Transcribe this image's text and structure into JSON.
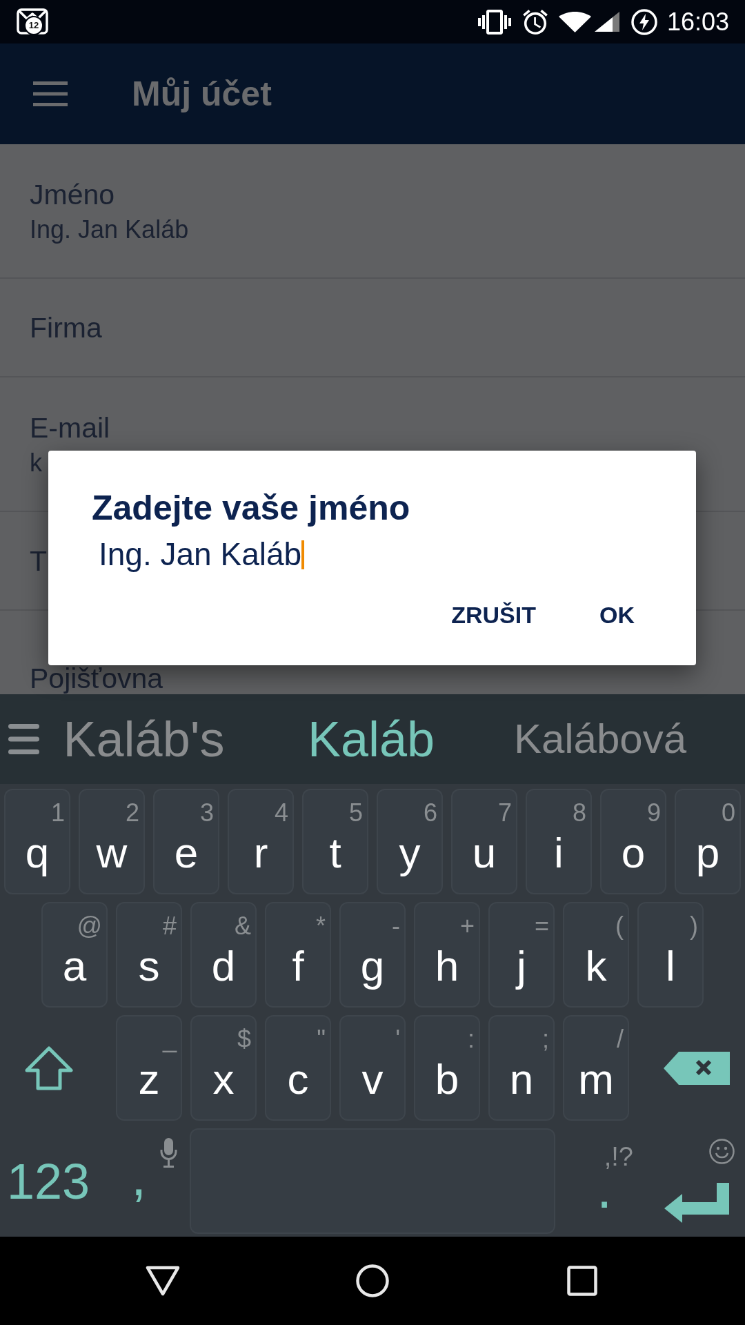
{
  "status_bar": {
    "notification_badge": "12",
    "time": "16:03"
  },
  "app_bar": {
    "title": "Můj účet"
  },
  "fields": [
    {
      "label": "Jméno",
      "value": "Ing. Jan Kaláb"
    },
    {
      "label": "Firma"
    },
    {
      "label": "E-mail",
      "value": "k"
    },
    {
      "label": "T"
    },
    {
      "label": "Pojišťovna"
    }
  ],
  "dialog": {
    "title": "Zadejte vaše jméno",
    "input_value": "Ing. Jan Kaláb",
    "buttons": [
      "ZRUŠIT",
      "OK"
    ]
  },
  "keyboard": {
    "suggestions": [
      {
        "text": "Kaláb's",
        "selected": false
      },
      {
        "text": "Kaláb",
        "selected": true
      },
      {
        "text": "Kalábová",
        "selected": false
      }
    ],
    "rows": [
      [
        {
          "key": "q",
          "hint": "1"
        },
        {
          "key": "w",
          "hint": "2"
        },
        {
          "key": "e",
          "hint": "3"
        },
        {
          "key": "r",
          "hint": "4"
        },
        {
          "key": "t",
          "hint": "5"
        },
        {
          "key": "y",
          "hint": "6"
        },
        {
          "key": "u",
          "hint": "7"
        },
        {
          "key": "i",
          "hint": "8"
        },
        {
          "key": "o",
          "hint": "9"
        },
        {
          "key": "p",
          "hint": "0"
        }
      ],
      [
        {
          "key": "a",
          "hint": "@"
        },
        {
          "key": "s",
          "hint": "#"
        },
        {
          "key": "d",
          "hint": "&"
        },
        {
          "key": "f",
          "hint": "*"
        },
        {
          "key": "g",
          "hint": "-"
        },
        {
          "key": "h",
          "hint": "+"
        },
        {
          "key": "j",
          "hint": "="
        },
        {
          "key": "k",
          "hint": "("
        },
        {
          "key": "l",
          "hint": ")"
        }
      ],
      [
        {
          "key": "z",
          "hint": "_"
        },
        {
          "key": "x",
          "hint": "$"
        },
        {
          "key": "c",
          "hint": "\""
        },
        {
          "key": "v",
          "hint": "'"
        },
        {
          "key": "b",
          "hint": ":"
        },
        {
          "key": "n",
          "hint": ";"
        },
        {
          "key": "m",
          "hint": "/"
        }
      ]
    ],
    "mode_key": "123",
    "comma_key": ",",
    "period_key": ".",
    "period_hint": ",!?"
  }
}
